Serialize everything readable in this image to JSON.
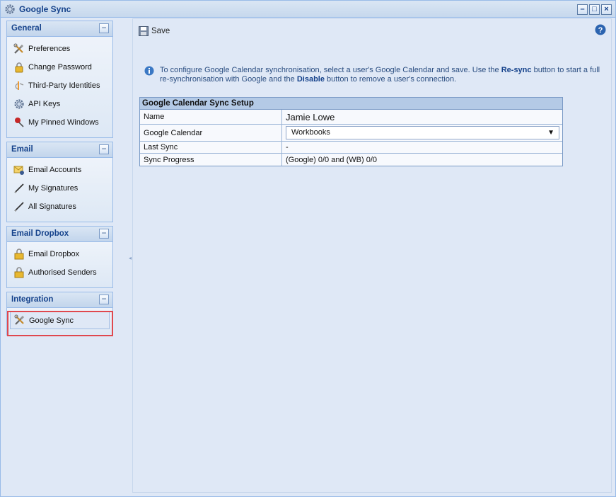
{
  "window": {
    "title": "Google Sync",
    "controls": [
      "minimize",
      "maximize",
      "close"
    ]
  },
  "sidebar": {
    "panels": [
      {
        "title": "General",
        "items": [
          {
            "label": "Preferences",
            "icon": "tools-icon"
          },
          {
            "label": "Change Password",
            "icon": "lock-icon"
          },
          {
            "label": "Third-Party Identities",
            "icon": "openid-icon"
          },
          {
            "label": "API Keys",
            "icon": "gear-icon"
          },
          {
            "label": "My Pinned Windows",
            "icon": "pin-icon"
          }
        ]
      },
      {
        "title": "Email",
        "items": [
          {
            "label": "Email Accounts",
            "icon": "email-gear-icon"
          },
          {
            "label": "My Signatures",
            "icon": "pen-icon"
          },
          {
            "label": "All Signatures",
            "icon": "pen-icon"
          }
        ]
      },
      {
        "title": "Email Dropbox",
        "items": [
          {
            "label": "Email Dropbox",
            "icon": "lock-box-icon"
          },
          {
            "label": "Authorised Senders",
            "icon": "lock-box-icon"
          }
        ]
      },
      {
        "title": "Integration",
        "items": [
          {
            "label": "Google Sync",
            "icon": "tools-icon",
            "selected": true
          }
        ]
      }
    ]
  },
  "toolbar": {
    "save_label": "Save"
  },
  "info": {
    "text_1": "To configure Google Calendar synchronisation, select a user's Google Calendar and save. Use the ",
    "resync": "Re-sync",
    "text_2": " button to start a full re-synchronisation with Google and the ",
    "disable": "Disable",
    "text_3": " button to remove a user's connection."
  },
  "setup": {
    "header": "Google Calendar Sync Setup",
    "rows": [
      {
        "label": "Name",
        "value": "Jamie Lowe"
      },
      {
        "label": "Google Calendar",
        "value": "Workbooks"
      },
      {
        "label": "Last Sync",
        "value": "-"
      },
      {
        "label": "Sync Progress",
        "value": "(Google) 0/0 and (WB) 0/0"
      }
    ]
  },
  "colors": {
    "accent": "#15428b",
    "panel_border": "#99bbe8",
    "highlight": "#e0484e"
  }
}
